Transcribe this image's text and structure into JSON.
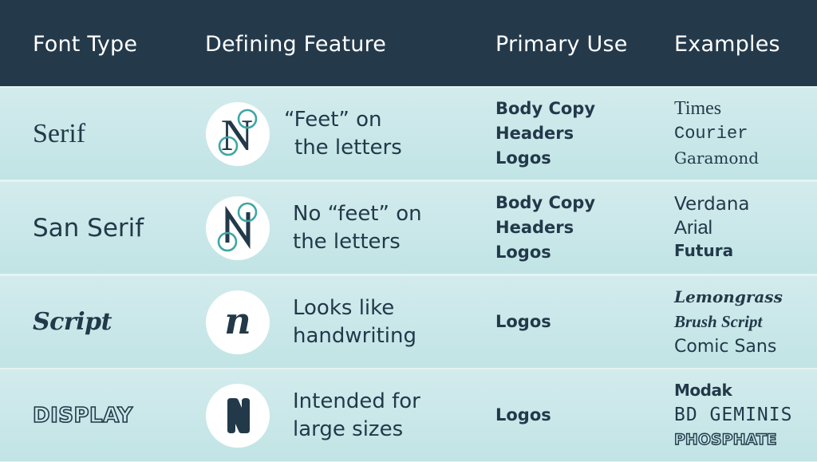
{
  "colors": {
    "header_bg": "#243a4b",
    "header_text": "#ffffff",
    "row_bg_top": "#d3ebed",
    "row_bg_bottom": "#c1e4e5",
    "text": "#22394a",
    "accent_teal": "#3fa6a3"
  },
  "header": {
    "columns": [
      "Font Type",
      "Defining Feature",
      "Primary Use",
      "Examples"
    ]
  },
  "rows": [
    {
      "type": "Serif",
      "icon": "serif-n-icon",
      "feature": [
        "“Feet” on",
        "the letters"
      ],
      "uses": [
        "Body Copy",
        "Headers",
        "Logos"
      ],
      "examples": [
        "Times",
        "Courier",
        "Garamond"
      ]
    },
    {
      "type": "San Serif",
      "icon": "sans-serif-n-icon",
      "feature": [
        "No “feet” on",
        "the letters"
      ],
      "uses": [
        "Body Copy",
        "Headers",
        "Logos"
      ],
      "examples": [
        "Verdana",
        "Arial",
        "Futura"
      ]
    },
    {
      "type": "Script",
      "icon": "script-n-icon",
      "feature": [
        "Looks like",
        "handwriting"
      ],
      "uses": [
        "Logos"
      ],
      "examples": [
        "Lemongrass",
        "Brush Script",
        "Comic Sans"
      ]
    },
    {
      "type": "DISPLAY",
      "icon": "display-n-icon",
      "feature": [
        "Intended for",
        "large sizes"
      ],
      "uses": [
        "Logos"
      ],
      "examples": [
        "Modak",
        "BD GEMINIS",
        "PHOSPHATE"
      ]
    }
  ]
}
